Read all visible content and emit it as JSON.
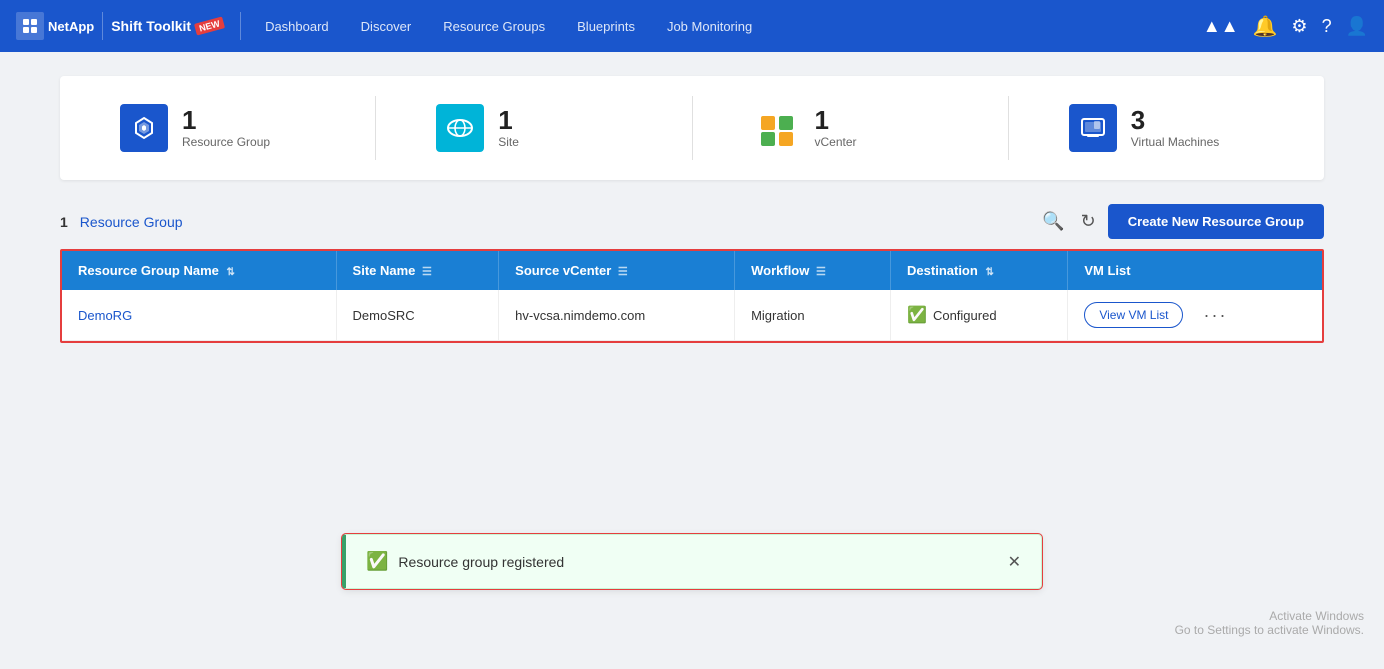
{
  "navbar": {
    "brand": "NetApp",
    "product": "Shift Toolkit",
    "badge": "NEW",
    "links": [
      "Dashboard",
      "Discover",
      "Resource Groups",
      "Blueprints",
      "Job Monitoring"
    ]
  },
  "stats": [
    {
      "count": "1",
      "label": "Resource Group",
      "icon": "shield"
    },
    {
      "count": "1",
      "label": "Site",
      "icon": "cloud"
    },
    {
      "count": "1",
      "label": "vCenter",
      "icon": "vcenter"
    },
    {
      "count": "3",
      "label": "Virtual Machines",
      "icon": "vm"
    }
  ],
  "section": {
    "count": "1",
    "label": "Resource Group",
    "create_btn": "Create New Resource Group"
  },
  "table": {
    "columns": [
      "Resource Group Name",
      "Site Name",
      "Source vCenter",
      "Workflow",
      "Destination",
      "VM List"
    ],
    "rows": [
      {
        "name": "DemoRG",
        "site": "DemoSRC",
        "vcenter": "hv-vcsa.nimdemo.com",
        "workflow": "Migration",
        "destination": "Configured",
        "vm_list_btn": "View VM List"
      }
    ]
  },
  "toast": {
    "message": "Resource group registered"
  },
  "watermark": {
    "line1": "Activate Windows",
    "line2": "Go to Settings to activate Windows."
  }
}
